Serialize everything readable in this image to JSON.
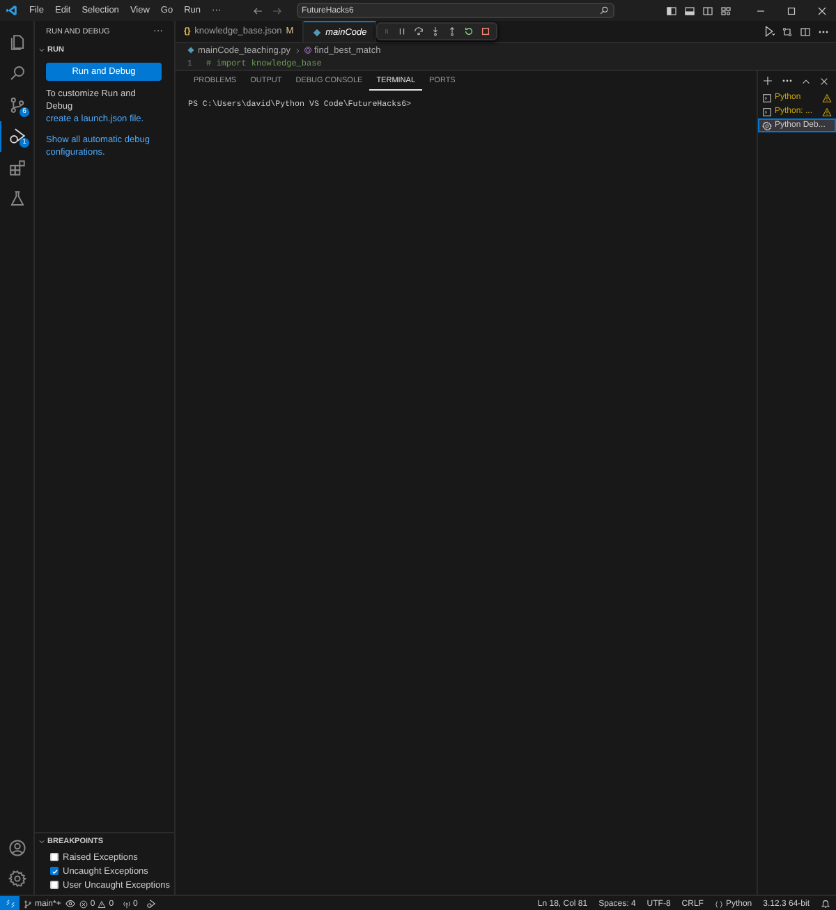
{
  "menu": [
    "File",
    "Edit",
    "Selection",
    "View",
    "Go",
    "Run",
    "···"
  ],
  "search": {
    "value": "FutureHacks6"
  },
  "activity": [
    {
      "kind": "explorer",
      "selected": false
    },
    {
      "kind": "search",
      "selected": false
    },
    {
      "kind": "scm",
      "selected": false,
      "badge": "6"
    },
    {
      "kind": "debug",
      "selected": true,
      "badge": "1"
    },
    {
      "kind": "extensions",
      "selected": false
    },
    {
      "kind": "testing",
      "selected": false
    }
  ],
  "sidebar": {
    "title": "RUN AND DEBUG",
    "more": "···",
    "run_section": {
      "title": "RUN",
      "expanded": true
    },
    "button": "Run and Debug",
    "hint": "To customize Run and Debug",
    "hint_link": "create a launch.json file.",
    "show_all_link": "Show all automatic debug configurations.",
    "breakpoints": {
      "title": "BREAKPOINTS",
      "expanded": true,
      "items": [
        {
          "label": "Raised Exceptions",
          "checked": false
        },
        {
          "label": "Uncaught Exceptions",
          "checked": true
        },
        {
          "label": "User Uncaught Exceptions",
          "checked": false
        }
      ]
    }
  },
  "tabs": [
    {
      "kind": "json",
      "icon": "{}",
      "label": "knowledge_base.json",
      "badge": "M",
      "selected": false
    },
    {
      "kind": "python",
      "label": "mainCode",
      "selected": true
    }
  ],
  "breadcrumb": [
    "mainCode_teaching.py",
    "find_best_match"
  ],
  "code": [
    {
      "number": "1",
      "text": "# import knowledge_base"
    }
  ],
  "panel_tabs": [
    {
      "label": "PROBLEMS",
      "selected": false
    },
    {
      "label": "OUTPUT",
      "selected": false
    },
    {
      "label": "DEBUG CONSOLE",
      "selected": false
    },
    {
      "label": "TERMINAL",
      "selected": true
    },
    {
      "label": "PORTS",
      "selected": false
    }
  ],
  "terminal": {
    "text": "PS C:\\Users\\david\\Python VS Code\\FutureHacks6>"
  },
  "terminals": [
    {
      "kind": "shell",
      "label": "Python",
      "warning": true,
      "selected": false
    },
    {
      "kind": "shell",
      "label": "Python: ...",
      "warning": true,
      "selected": false
    },
    {
      "kind": "debug",
      "label": "Python Deb...",
      "warning": false,
      "selected": true
    }
  ],
  "status": {
    "branch": "main*+",
    "errors": "0",
    "warnings": "0",
    "ports": "0",
    "right": [
      {
        "kind": "text",
        "label": "Ln 18, Col 81"
      },
      {
        "kind": "text",
        "label": "Spaces: 4"
      },
      {
        "kind": "text",
        "label": "UTF-8"
      },
      {
        "kind": "text",
        "label": "CRLF"
      },
      {
        "kind": "language",
        "label": "Python"
      },
      {
        "kind": "text",
        "label": "3.12.3 64-bit"
      }
    ]
  }
}
